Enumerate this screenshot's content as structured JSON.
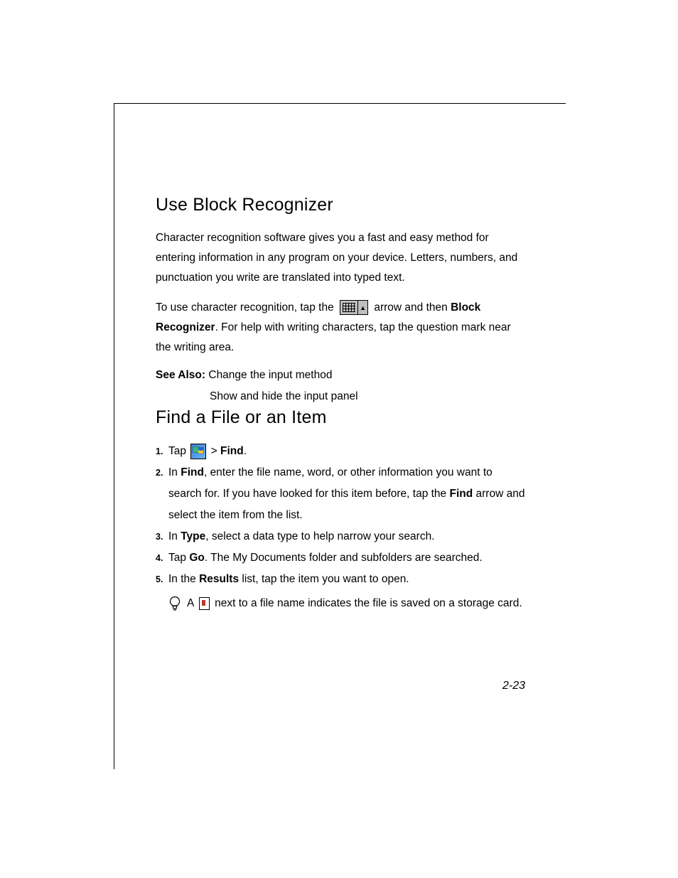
{
  "section1": {
    "heading": "Use Block Recognizer",
    "para1": "Character recognition software gives you a fast and easy method for entering information in any program on your device. Letters, numbers, and punctuation you write are translated into typed text.",
    "para2_pre": "To use character recognition, tap the ",
    "para2_mid": " arrow and then ",
    "para2_bold": "Block Recognizer",
    "para2_post": ". For help with writing characters, tap the question mark near the writing area.",
    "see_also_label": "See Also:",
    "see_also_1": " Change the input method",
    "see_also_2": "Show and hide the input panel"
  },
  "section2": {
    "heading": "Find a File or an Item",
    "step1_pre": "Tap ",
    "step1_gt": " > ",
    "step1_bold": "Find",
    "step1_post": ".",
    "step2_pre": "In ",
    "step2_bold1": "Find",
    "step2_mid": ", enter the file name, word, or other information you want to search for. If you have looked for this item before, tap the ",
    "step2_bold2": "Find",
    "step2_post": " arrow and select the item from the list.",
    "step3_pre": "In ",
    "step3_bold": "Type",
    "step3_post": ", select a data type to help narrow your search.",
    "step4_pre": "Tap ",
    "step4_bold": "Go",
    "step4_post": ". The My Documents folder and subfolders are searched.",
    "step5_pre": "In the ",
    "step5_bold": "Results",
    "step5_post": " list, tap the item you want to open.",
    "tip_pre": "A ",
    "tip_post": " next to a file name indicates the file is saved on a storage card."
  },
  "page_number": "2-23"
}
